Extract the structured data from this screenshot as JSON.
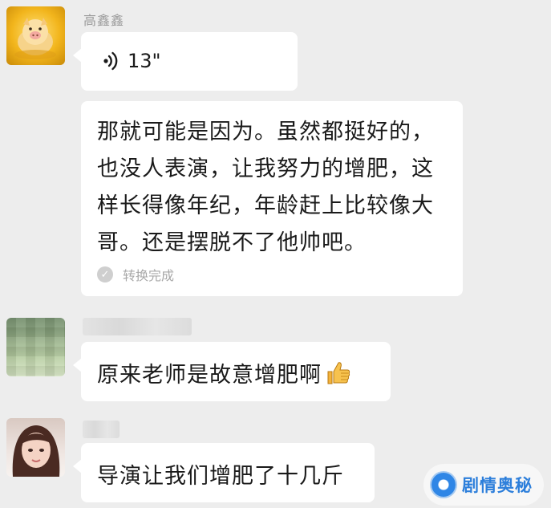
{
  "messages": [
    {
      "sender": "高鑫鑫",
      "voice": {
        "duration": "13\""
      },
      "transcript": {
        "text": "那就可能是因为。虽然都挺好的，也没人表演，让我努力的增肥，这样长得像年纪，年龄赶上比较像大哥。还是摆脱不了他帅吧。",
        "status": "转换完成"
      }
    },
    {
      "sender": "",
      "text": "原来老师是故意增肥啊",
      "emoji": "thumbs-up"
    },
    {
      "sender": "",
      "text": "导演让我们增肥了十几斤"
    }
  ],
  "watermark": {
    "text": "剧情奥秘"
  },
  "colors": {
    "background": "#ededed",
    "bubble": "#ffffff",
    "watermark": "#2d7fdb"
  }
}
